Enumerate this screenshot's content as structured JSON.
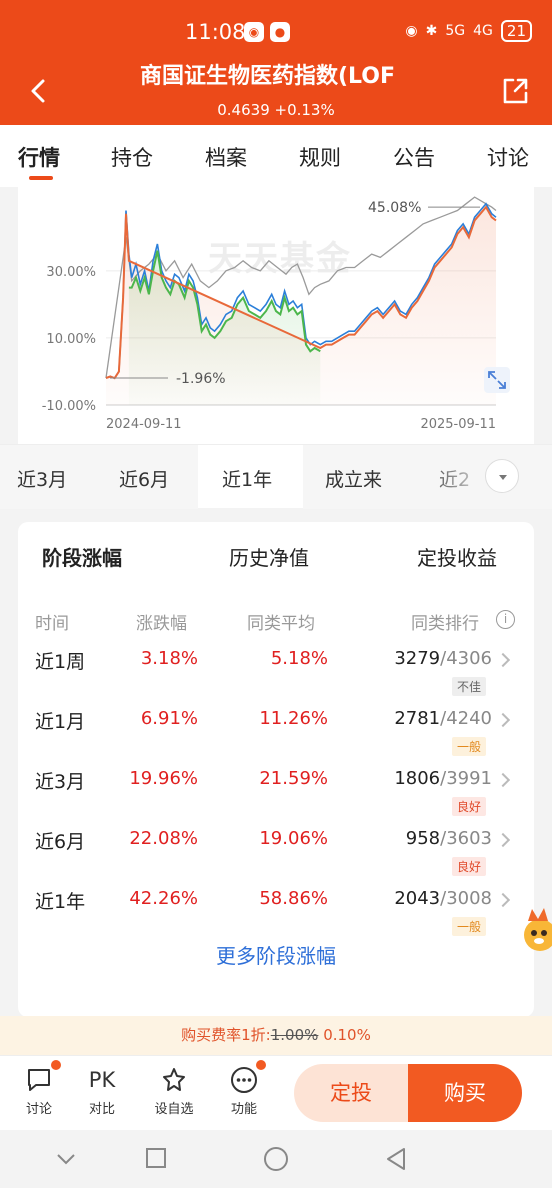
{
  "status_bar": {
    "time": "11:08",
    "signal_5g": "5G",
    "signal_4g": "4G",
    "battery": "21"
  },
  "header": {
    "title": "商国证生物医药指数(LOF",
    "nav_value": "0.4639 +0.13%"
  },
  "tabs": [
    {
      "label": "行情"
    },
    {
      "label": "持仓"
    },
    {
      "label": "档案"
    },
    {
      "label": "规则"
    },
    {
      "label": "公告"
    },
    {
      "label": "讨论"
    }
  ],
  "chart_data": {
    "type": "line",
    "y_tick_labels": [
      "30.00%",
      "10.00%",
      "-10.00%"
    ],
    "x_tick_labels": [
      "2024-09-11",
      "2025-09-11"
    ],
    "ylim": [
      -10,
      55
    ],
    "watermark": "天天基金",
    "annotations": [
      {
        "text": "45.08%"
      },
      {
        "text": "-1.96%"
      }
    ],
    "series": [
      {
        "color": "#2b7fd9",
        "points": [
          [
            0,
            -1.96
          ],
          [
            3,
            -1.5
          ],
          [
            6,
            -2
          ],
          [
            9,
            0
          ],
          [
            12,
            22
          ],
          [
            14,
            48
          ],
          [
            16,
            35
          ],
          [
            18,
            28
          ],
          [
            21,
            32
          ],
          [
            24,
            26
          ],
          [
            27,
            30
          ],
          [
            30,
            24
          ],
          [
            33,
            33
          ],
          [
            36,
            38
          ],
          [
            39,
            30
          ],
          [
            42,
            27
          ],
          [
            45,
            25
          ],
          [
            48,
            29
          ],
          [
            51,
            28
          ],
          [
            55,
            24
          ],
          [
            58,
            29
          ],
          [
            61,
            27
          ],
          [
            64,
            22
          ],
          [
            67,
            14
          ],
          [
            70,
            16
          ],
          [
            73,
            13
          ],
          [
            76,
            12
          ],
          [
            80,
            14
          ],
          [
            84,
            17
          ],
          [
            88,
            18
          ],
          [
            92,
            22
          ],
          [
            96,
            24
          ],
          [
            100,
            20
          ],
          [
            104,
            19
          ],
          [
            108,
            18
          ],
          [
            112,
            20
          ],
          [
            116,
            23
          ],
          [
            119,
            20
          ],
          [
            122,
            19
          ],
          [
            125,
            24
          ],
          [
            128,
            20
          ],
          [
            131,
            21
          ],
          [
            134,
            19
          ],
          [
            137,
            20
          ],
          [
            140,
            10
          ],
          [
            143,
            8
          ],
          [
            146,
            9
          ],
          [
            150,
            8
          ],
          [
            154,
            9
          ],
          [
            158,
            9
          ],
          [
            162,
            10
          ],
          [
            166,
            11
          ],
          [
            170,
            12
          ],
          [
            174,
            12
          ],
          [
            178,
            14
          ],
          [
            182,
            16
          ],
          [
            186,
            18
          ],
          [
            190,
            19
          ],
          [
            194,
            17
          ],
          [
            198,
            19
          ],
          [
            202,
            21
          ],
          [
            206,
            18
          ],
          [
            210,
            17
          ],
          [
            214,
            20
          ],
          [
            218,
            22
          ],
          [
            222,
            25
          ],
          [
            226,
            28
          ],
          [
            230,
            32
          ],
          [
            234,
            34
          ],
          [
            238,
            36
          ],
          [
            242,
            38
          ],
          [
            246,
            42
          ],
          [
            250,
            44
          ],
          [
            254,
            41
          ],
          [
            258,
            46
          ],
          [
            262,
            48
          ],
          [
            266,
            50
          ],
          [
            270,
            47
          ],
          [
            273,
            46
          ]
        ]
      },
      {
        "color": "#4cb64c",
        "points": [
          [
            16,
            25
          ],
          [
            18,
            25
          ],
          [
            21,
            28
          ],
          [
            24,
            24
          ],
          [
            27,
            28
          ],
          [
            30,
            23
          ],
          [
            33,
            30
          ],
          [
            36,
            36
          ],
          [
            39,
            28
          ],
          [
            42,
            25
          ],
          [
            45,
            23
          ],
          [
            48,
            27
          ],
          [
            51,
            26
          ],
          [
            55,
            22
          ],
          [
            58,
            27
          ],
          [
            61,
            25
          ],
          [
            64,
            20
          ],
          [
            67,
            12
          ],
          [
            70,
            14
          ],
          [
            73,
            11
          ],
          [
            76,
            10
          ],
          [
            80,
            12
          ],
          [
            84,
            15
          ],
          [
            88,
            16
          ],
          [
            92,
            20
          ],
          [
            96,
            22
          ],
          [
            100,
            18
          ],
          [
            104,
            17
          ],
          [
            108,
            16
          ],
          [
            112,
            18
          ],
          [
            116,
            21
          ],
          [
            119,
            18
          ],
          [
            122,
            17
          ],
          [
            125,
            22
          ],
          [
            128,
            18
          ],
          [
            131,
            19
          ],
          [
            134,
            17
          ],
          [
            137,
            18
          ],
          [
            140,
            8
          ],
          [
            143,
            6
          ],
          [
            146,
            7
          ],
          [
            150,
            6
          ]
        ]
      },
      {
        "color": "#e8693a",
        "points": [
          [
            0,
            -1.96
          ],
          [
            3,
            -1.5
          ],
          [
            6,
            -2
          ],
          [
            9,
            0
          ],
          [
            12,
            22
          ],
          [
            14,
            47
          ],
          [
            16,
            33
          ],
          [
            150,
            7
          ],
          [
            154,
            8
          ],
          [
            158,
            8
          ],
          [
            162,
            9
          ],
          [
            166,
            10
          ],
          [
            170,
            11
          ],
          [
            174,
            11
          ],
          [
            178,
            13
          ],
          [
            182,
            15
          ],
          [
            186,
            17
          ],
          [
            190,
            18
          ],
          [
            194,
            16
          ],
          [
            198,
            18
          ],
          [
            202,
            20
          ],
          [
            206,
            17
          ],
          [
            210,
            16
          ],
          [
            214,
            19
          ],
          [
            218,
            21
          ],
          [
            222,
            24
          ],
          [
            226,
            27
          ],
          [
            230,
            31
          ],
          [
            234,
            33
          ],
          [
            238,
            35
          ],
          [
            242,
            37
          ],
          [
            246,
            41
          ],
          [
            250,
            43
          ],
          [
            254,
            40
          ],
          [
            258,
            45
          ],
          [
            262,
            47
          ],
          [
            266,
            49
          ],
          [
            270,
            46
          ],
          [
            273,
            45
          ]
        ]
      },
      {
        "color": "#9a9a9a",
        "points": [
          [
            0,
            -1.96
          ],
          [
            14,
            40
          ],
          [
            18,
            27
          ],
          [
            24,
            30
          ],
          [
            30,
            32
          ],
          [
            36,
            35
          ],
          [
            42,
            30
          ],
          [
            48,
            33
          ],
          [
            54,
            28
          ],
          [
            60,
            32
          ],
          [
            66,
            27
          ],
          [
            72,
            25
          ],
          [
            78,
            27
          ],
          [
            84,
            30
          ],
          [
            90,
            31
          ],
          [
            96,
            33
          ],
          [
            102,
            31
          ],
          [
            108,
            30
          ],
          [
            114,
            33
          ],
          [
            120,
            31
          ],
          [
            126,
            29
          ],
          [
            130,
            31
          ],
          [
            134,
            32
          ],
          [
            138,
            28
          ],
          [
            142,
            23
          ],
          [
            146,
            25
          ],
          [
            150,
            26
          ],
          [
            156,
            27
          ],
          [
            162,
            30
          ],
          [
            168,
            31
          ],
          [
            174,
            31
          ],
          [
            180,
            33
          ],
          [
            186,
            35
          ],
          [
            192,
            34
          ],
          [
            198,
            36
          ],
          [
            204,
            38
          ],
          [
            210,
            40
          ],
          [
            216,
            42
          ],
          [
            222,
            44
          ],
          [
            228,
            45
          ],
          [
            234,
            46
          ],
          [
            240,
            47
          ],
          [
            246,
            48
          ],
          [
            252,
            50
          ],
          [
            258,
            52
          ],
          [
            262,
            51
          ],
          [
            266,
            50
          ],
          [
            270,
            49
          ],
          [
            273,
            48
          ]
        ]
      }
    ]
  },
  "periods": [
    {
      "label": "近3月"
    },
    {
      "label": "近6月"
    },
    {
      "label": "近1年",
      "active": true
    },
    {
      "label": "成立来"
    },
    {
      "label": "近2"
    }
  ],
  "performance": {
    "sub_tabs": [
      "阶段涨幅",
      "历史净值",
      "定投收益"
    ],
    "headers": [
      "时间",
      "涨跌幅",
      "同类平均",
      "同类排行"
    ],
    "rows": [
      {
        "period": "近1周",
        "change": "3.18%",
        "avg": "5.18%",
        "rank": "3279",
        "total": "/4306",
        "badge": "不佳",
        "badge_type": "gray"
      },
      {
        "period": "近1月",
        "change": "6.91%",
        "avg": "11.26%",
        "rank": "2781",
        "total": "/4240",
        "badge": "一般",
        "badge_type": "orange"
      },
      {
        "period": "近3月",
        "change": "19.96%",
        "avg": "21.59%",
        "rank": "1806",
        "total": "/3991",
        "badge": "良好",
        "badge_type": "red"
      },
      {
        "period": "近6月",
        "change": "22.08%",
        "avg": "19.06%",
        "rank": "958",
        "total": "/3603",
        "badge": "良好",
        "badge_type": "red"
      },
      {
        "period": "近1年",
        "change": "42.26%",
        "avg": "58.86%",
        "rank": "2043",
        "total": "/3008",
        "badge": "一般",
        "badge_type": "orange"
      }
    ],
    "more_link": "更多阶段涨幅"
  },
  "fee_bar": {
    "prefix": "购买费率1折:",
    "old_rate": "1.00%",
    "new_rate": "0.10%"
  },
  "bottom_bar": {
    "items": [
      {
        "label": "讨论"
      },
      {
        "label": "对比",
        "icon_text": "PK"
      },
      {
        "label": "设自选"
      },
      {
        "label": "功能"
      }
    ],
    "dingtou_label": "定投",
    "buy_label": "购买"
  },
  "colors": {
    "brand": "#ec4a19",
    "buy_button": "#f25a22",
    "up_red": "#e02020",
    "link_blue": "#2e6fd8"
  }
}
